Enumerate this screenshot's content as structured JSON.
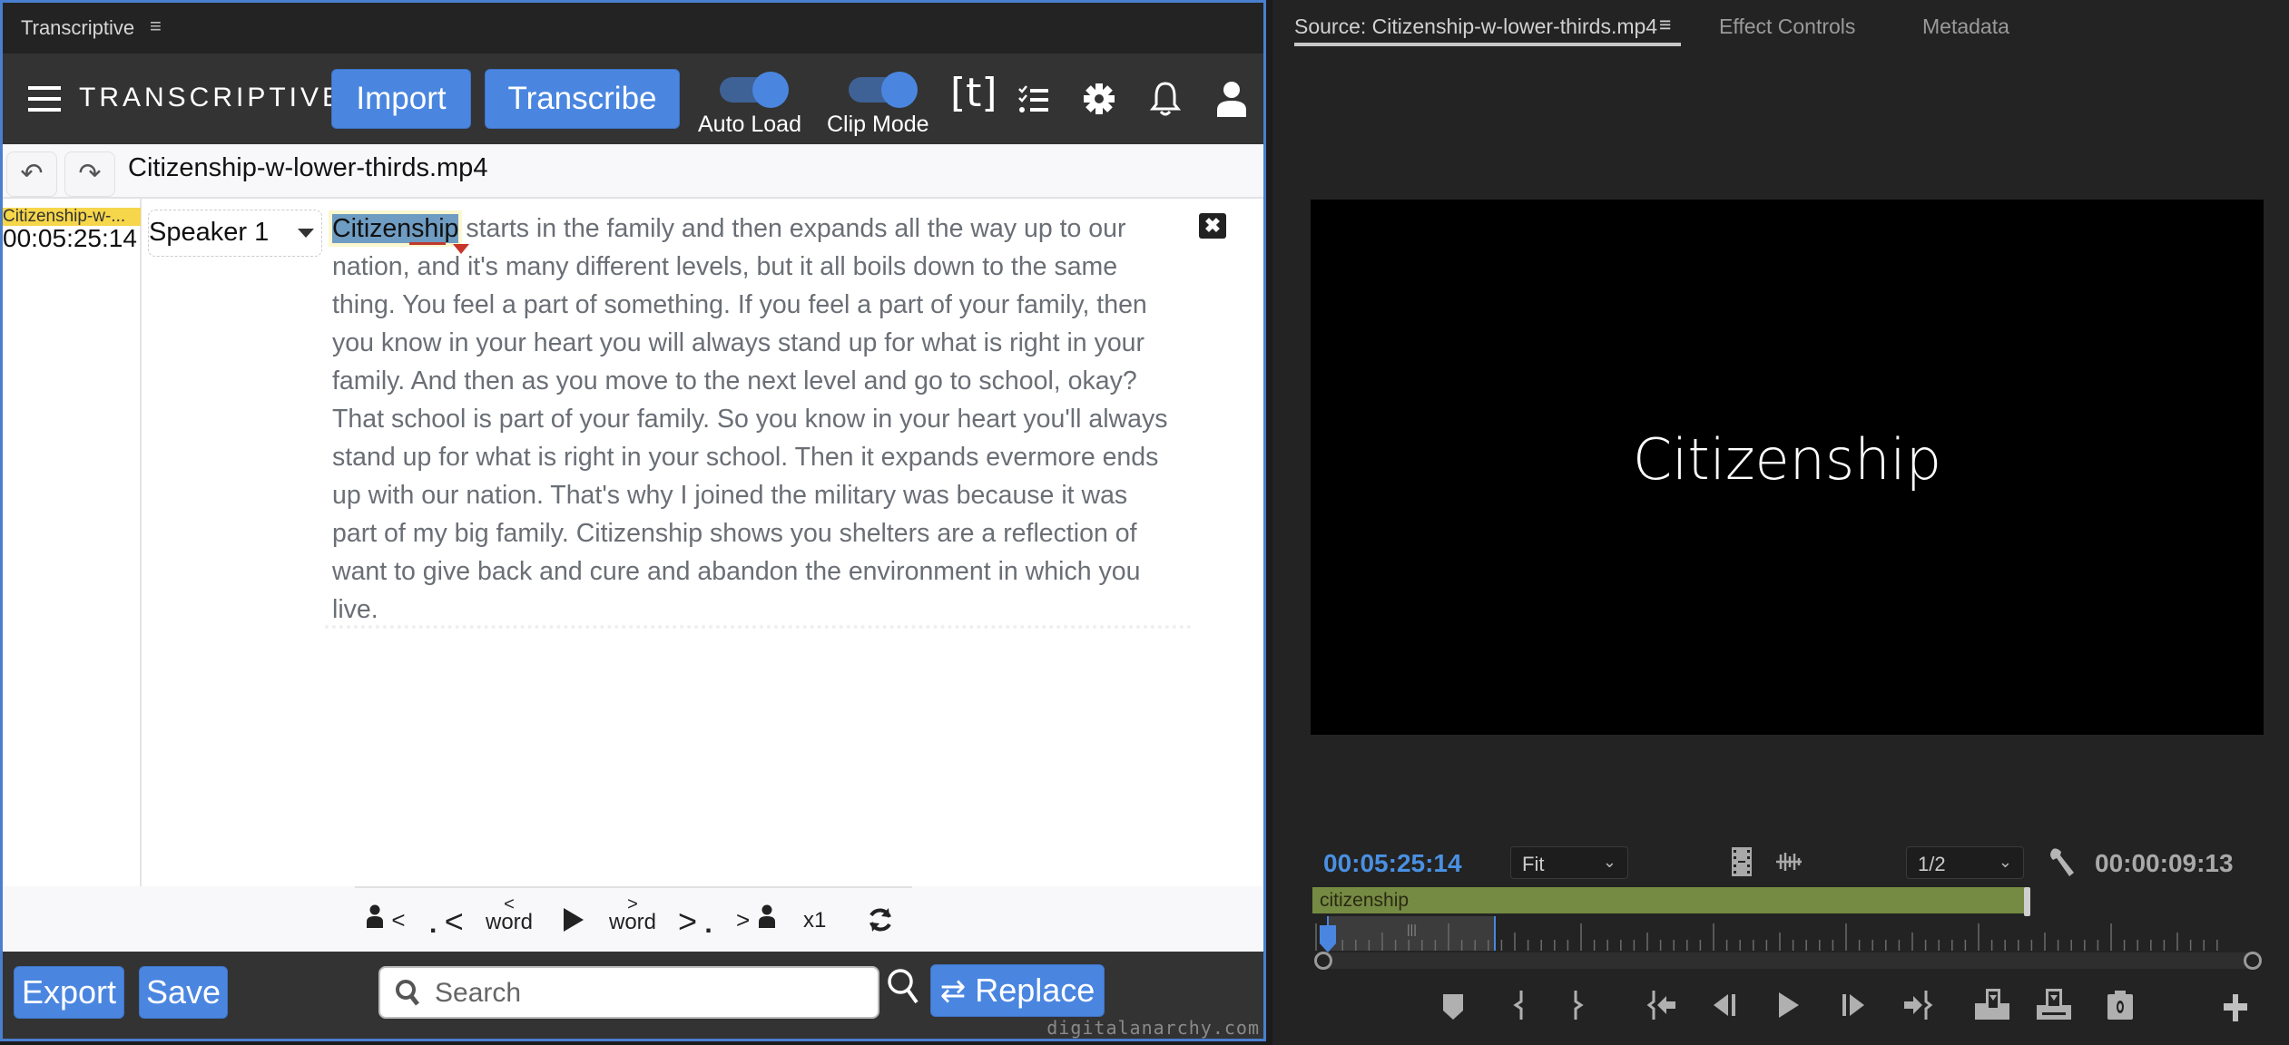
{
  "left_panel": {
    "title": "Transcriptive",
    "title_menu_icon": "hamburger-menu-icon",
    "toolbar": {
      "brand": "TRANSCRIPTIVE",
      "import_label": "Import",
      "transcribe_label": "Transcribe",
      "auto_load_label": "Auto Load",
      "auto_load_on": true,
      "clip_mode_label": "Clip Mode",
      "clip_mode_on": true,
      "t_icon": "[t]",
      "accent": "#4a86e0"
    },
    "file": {
      "undo_icon": "↶",
      "redo_icon": "↷",
      "filename": "Citizenship-w-lower-thirds.mp4"
    },
    "transcript": {
      "clip_label": "Citizenship-w-...",
      "timecode": "00:05:25:14",
      "speaker": "Speaker 1",
      "highlighted_word": "Citizenship",
      "text": " starts in the family and then expands all the way up to our nation, and it's many different levels, but it all boils down to the same thing. You feel a part of something. If you feel a part of your family, then you know in your heart you will always stand up for what is right in your family. And then as you move to the next level and go to school, okay? That school is part of your family. So you know in your heart you'll always stand up for what is right in your school. Then it expands evermore ends up with our nation. That's why I joined the military was because it was part of my big family. Citizenship shows you shelters are a reflection of want to give back and cure and abandon the environment in which you live.",
      "close_label": "✖"
    },
    "nav": {
      "prev_speaker": "<",
      "prev_sentence": "<",
      "prev_word_arrow": "<",
      "prev_word": "word",
      "next_word_arrow": ">",
      "next_word": "word",
      "next_sentence": ">",
      "next_speaker": ">",
      "speed": "x1"
    },
    "bottom": {
      "export_label": "Export",
      "save_label": "Save",
      "search_placeholder": "Search",
      "search_value": "",
      "replace_label": "Replace",
      "credit": "digitalanarchy.com"
    }
  },
  "right_panel": {
    "tabs": [
      {
        "label": "Source: Citizenship-w-lower-thirds.mp4",
        "active": true
      },
      {
        "label": "Effect Controls",
        "active": false
      },
      {
        "label": "Metadata",
        "active": false
      }
    ],
    "tab_menu_icon": "≡",
    "video_title": "Citizenship",
    "current_timecode": "00:05:25:14",
    "zoom_select": "Fit",
    "resolution_select": "1/2",
    "duration": "00:00:09:13",
    "clip_name": "citizenship",
    "clip_color": "#758a42",
    "timecode_color": "#4a90e2"
  }
}
